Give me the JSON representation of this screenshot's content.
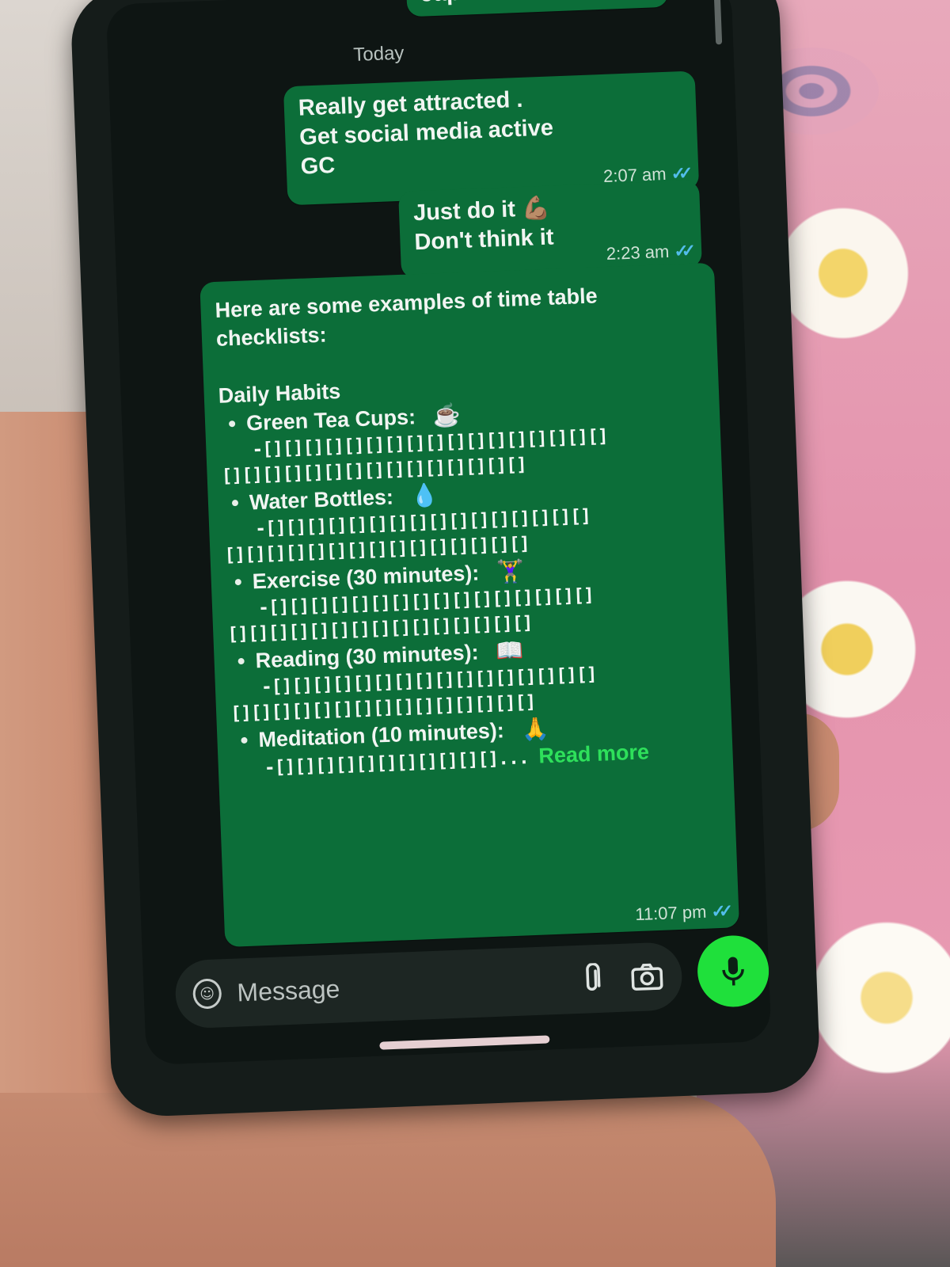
{
  "chat": {
    "previous_message_fragment": "Japan",
    "date_separator": "Today",
    "messages": [
      {
        "text": "Really get attracted .\nGet social media active\nGC",
        "time": "2:07 am",
        "status": "read"
      },
      {
        "text": "Just do it 💪🏽\nDon't think it",
        "time": "2:23 am",
        "status": "read"
      },
      {
        "intro": "Here are some examples of time table checklists:",
        "heading": "Daily Habits",
        "items": [
          {
            "label": "Green Tea Cups:",
            "emoji": "☕",
            "boxes_line1": "-[][][][][][][][][][][][][][][][][]",
            "boxes_line2": "[][][][][][][][][][][][][][][]"
          },
          {
            "label": "Water Bottles:",
            "emoji": "💧",
            "boxes_line1": "-[][][][][][][][][][][][][][][][]",
            "boxes_line2": "[][][][][][][][][][][][][][][]"
          },
          {
            "label": "Exercise (30 minutes):",
            "emoji": "🏋️‍♀️",
            "boxes_line1": "-[][][][][][][][][][][][][][][][]",
            "boxes_line2": "[][][][][][][][][][][][][][][]"
          },
          {
            "label": "Reading (30 minutes):",
            "emoji": "📖",
            "boxes_line1": "-[][][][][][][][][][][][][][][][]",
            "boxes_line2": "[][][][][][][][][][][][][][][]"
          },
          {
            "label": "Meditation (10 minutes):",
            "emoji": "🙏",
            "boxes_line1": "-[][][][][][][][][][][]..."
          }
        ],
        "read_more": "Read more",
        "time": "11:07 pm",
        "status": "read"
      }
    ]
  },
  "composer": {
    "placeholder": "Message",
    "icons": [
      "sticker-icon",
      "paperclip-icon",
      "camera-icon",
      "microphone-icon"
    ]
  },
  "colors": {
    "outgoing_bubble": "#0c6e39",
    "read_ticks": "#53bdeb",
    "read_more_link": "#2ee05b",
    "mic_button": "#1fe03b",
    "chat_background": "#0e1513"
  }
}
